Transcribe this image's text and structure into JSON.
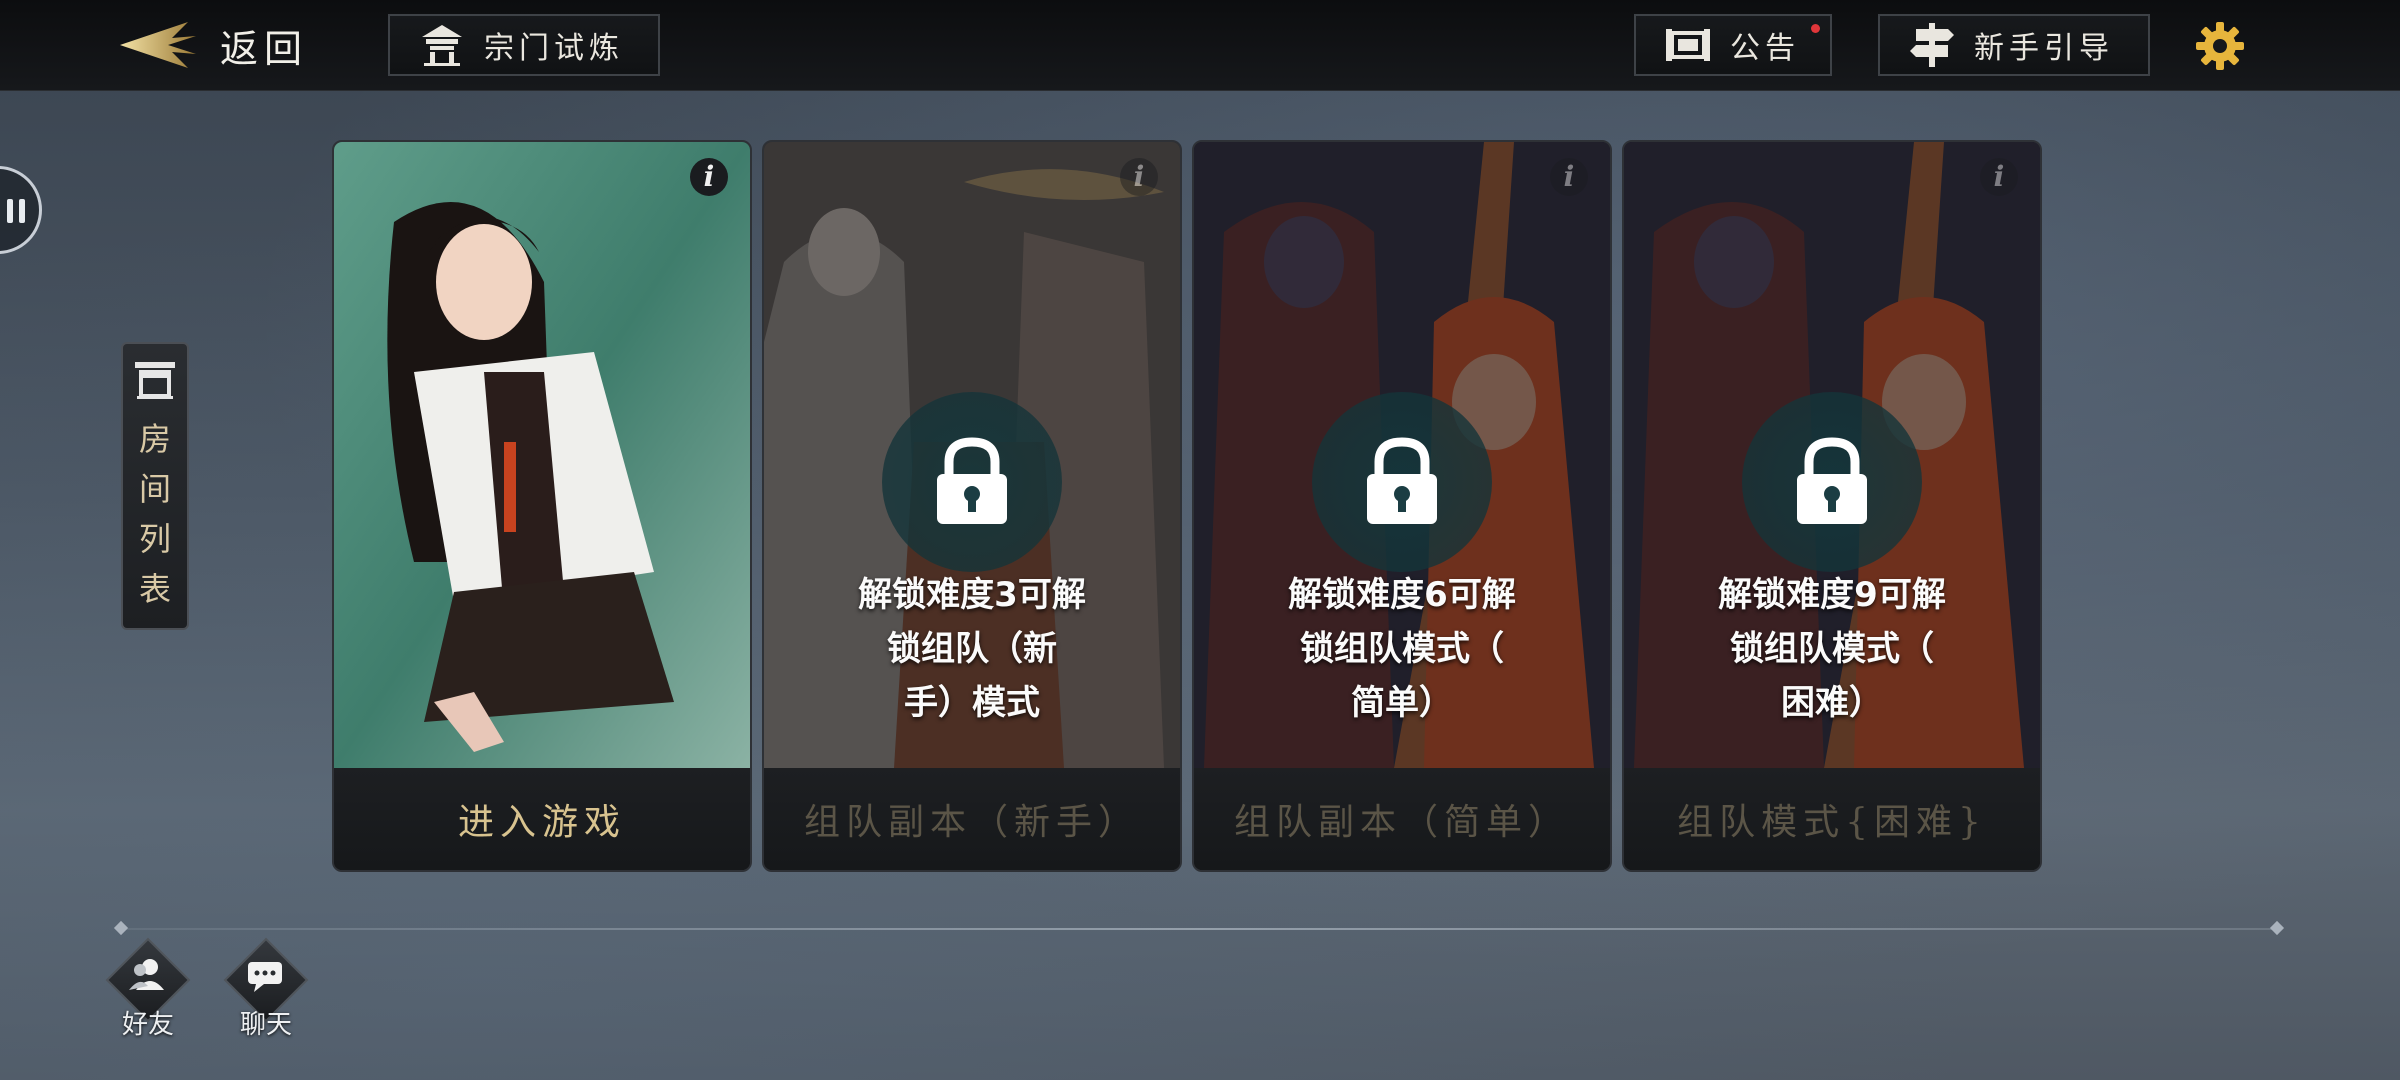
{
  "topbar": {
    "back_label": "返回",
    "sect_trial_label": "宗门试炼",
    "notice_label": "公告",
    "guide_label": "新手引导"
  },
  "sidebar": {
    "room_list_label": "房间列表"
  },
  "cards": [
    {
      "name": "enter-game",
      "footer_label": "进入游戏",
      "locked": false,
      "info": "i"
    },
    {
      "name": "team-dungeon-novice",
      "footer_label": "组队副本（新手）",
      "locked": true,
      "lock_line1": "解锁难度3可解",
      "lock_line2": "锁组队（新",
      "lock_line3": "手）模式",
      "info": "i"
    },
    {
      "name": "team-dungeon-easy",
      "footer_label": "组队副本（简单）",
      "locked": true,
      "lock_line1": "解锁难度6可解",
      "lock_line2": "锁组队模式（",
      "lock_line3": "简单）",
      "info": "i"
    },
    {
      "name": "team-mode-hard",
      "footer_label": "组队模式{困难}",
      "locked": true,
      "lock_line1": "解锁难度9可解",
      "lock_line2": "锁组队模式（",
      "lock_line3": "困难）",
      "info": "i"
    }
  ],
  "bottom": {
    "friends_label": "好友",
    "chat_label": "聊天"
  },
  "colors": {
    "accent_gold": "#d8c38f",
    "notice_dot": "#e0363a",
    "gear": "#e7b53c"
  }
}
